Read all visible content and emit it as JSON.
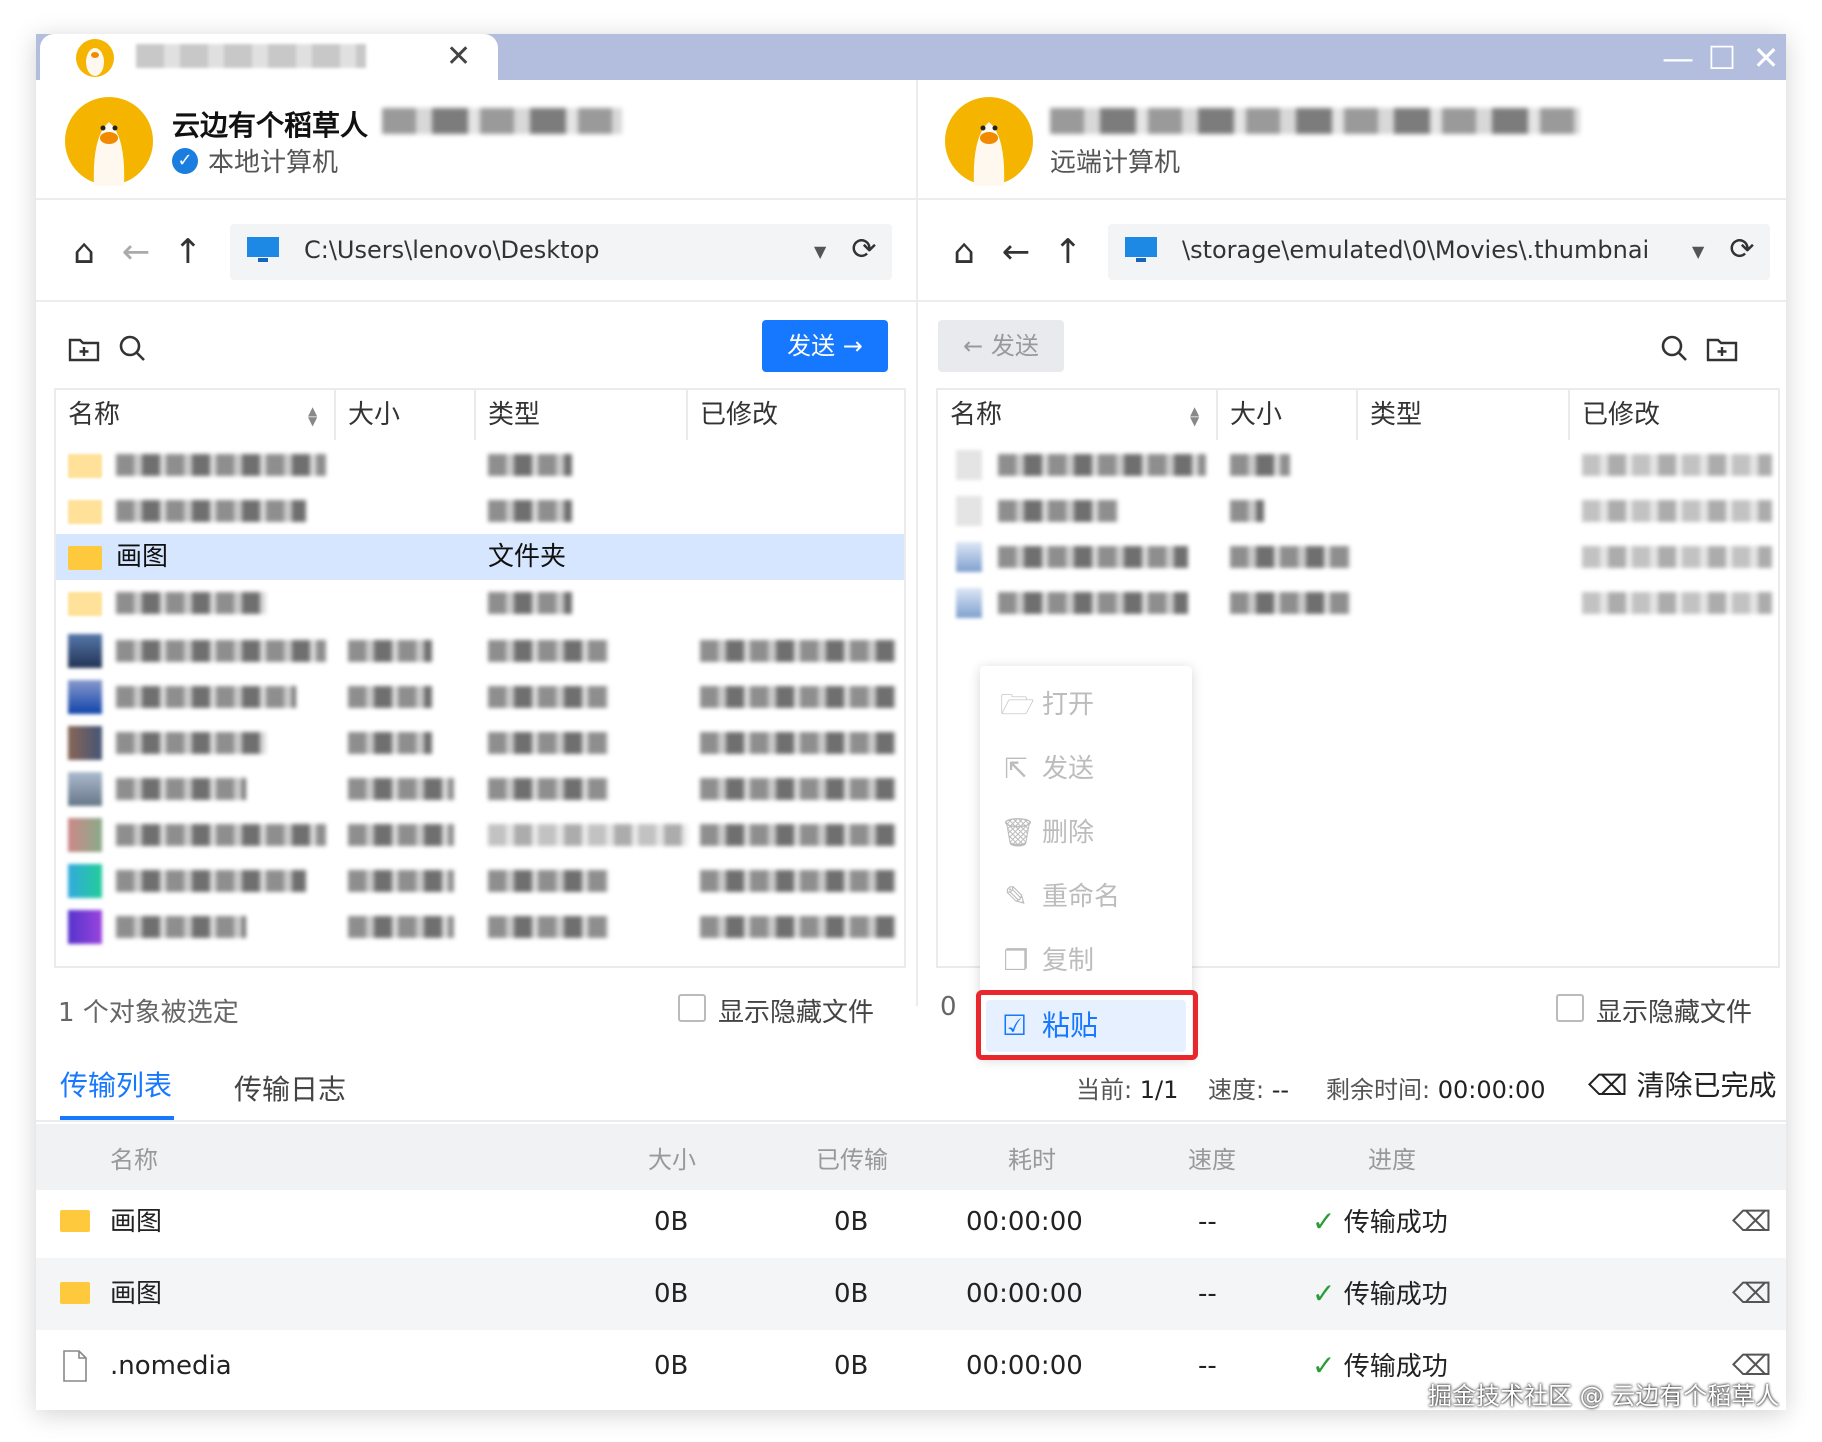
{
  "window": {
    "tab_close": "✕",
    "controls": {
      "minimize": "—",
      "maximize": "☐",
      "close": "✕"
    }
  },
  "local": {
    "user_name": "云边有个稻草人",
    "label": "本地计算机",
    "path": "C:\\Users\\lenovo\\Desktop",
    "send_label": "发送 →",
    "columns": [
      "名称",
      "大小",
      "类型",
      "已修改"
    ],
    "selected_row": {
      "name": "画图",
      "type": "文件夹"
    },
    "status": "1 个对象被选定",
    "show_hidden": "显示隐藏文件"
  },
  "remote": {
    "label": "远端计算机",
    "path": "\\storage\\emulated\\0\\Movies\\.thumbnai",
    "send_label": "← 发送",
    "columns": [
      "名称",
      "大小",
      "类型",
      "已修改"
    ],
    "status": "0",
    "show_hidden": "显示隐藏文件"
  },
  "context_menu": {
    "items": [
      {
        "icon": "open-icon",
        "label": "打开",
        "enabled": false
      },
      {
        "icon": "send-icon",
        "label": "发送",
        "enabled": false
      },
      {
        "icon": "trash-icon",
        "label": "删除",
        "enabled": false
      },
      {
        "icon": "rename-icon",
        "label": "重命名",
        "enabled": false
      },
      {
        "icon": "copy-icon",
        "label": "复制",
        "enabled": false
      }
    ],
    "paste": {
      "icon": "paste-icon",
      "label": "粘贴",
      "enabled": true
    }
  },
  "transfer": {
    "tabs": [
      "传输列表",
      "传输日志"
    ],
    "current_label": "当前:",
    "current_value": "1/1",
    "speed_label": "速度:",
    "speed_value": "--",
    "remaining_label": "剩余时间:",
    "remaining_value": "00:00:00",
    "clear_label": "清除已完成",
    "columns": [
      "名称",
      "大小",
      "已传输",
      "耗时",
      "速度",
      "进度"
    ],
    "rows": [
      {
        "icon": "folder",
        "name": "画图",
        "size": "0B",
        "transferred": "0B",
        "elapsed": "00:00:00",
        "speed": "--",
        "progress": "传输成功"
      },
      {
        "icon": "folder",
        "name": "画图",
        "size": "0B",
        "transferred": "0B",
        "elapsed": "00:00:00",
        "speed": "--",
        "progress": "传输成功"
      },
      {
        "icon": "file",
        "name": ".nomedia",
        "size": "0B",
        "transferred": "0B",
        "elapsed": "00:00:00",
        "speed": "--",
        "progress": "传输成功"
      }
    ]
  },
  "watermark": "掘金技术社区 @ 云边有个稻草人",
  "colors": {
    "accent": "#1677ff",
    "titlebar": "#b3bedf",
    "selected_row": "#d7e6ff",
    "highlight": "#e8262c",
    "success": "#2a9d38"
  }
}
